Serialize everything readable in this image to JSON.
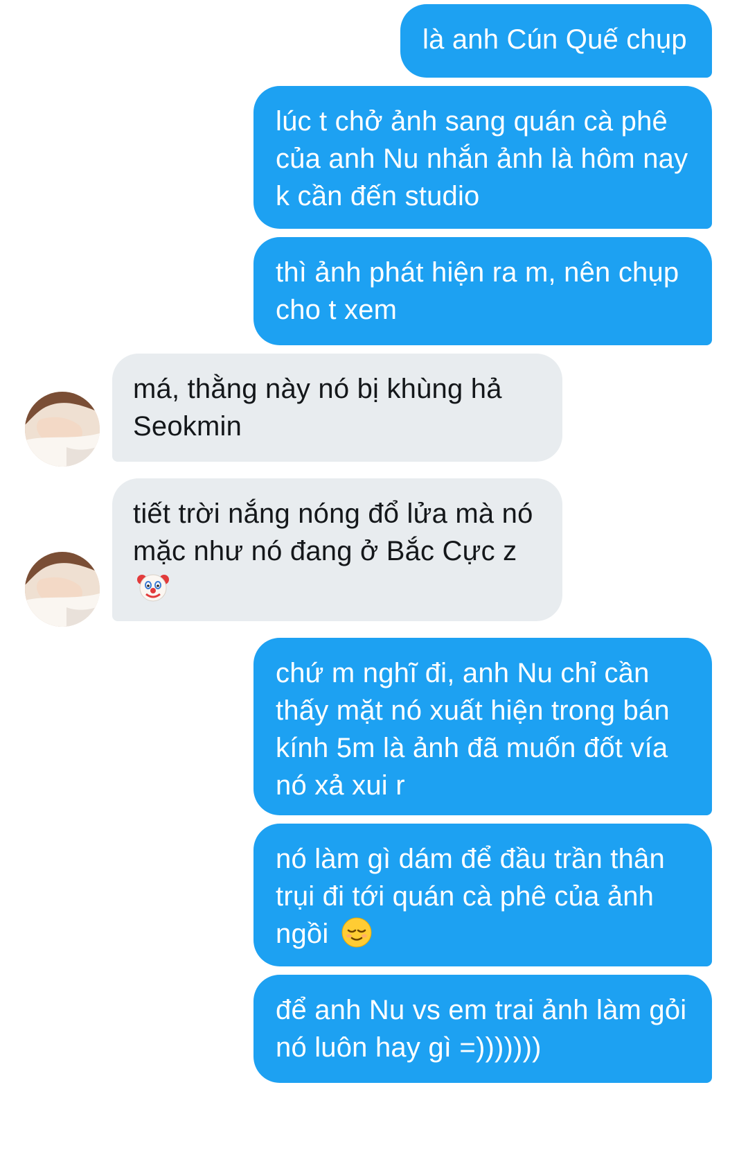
{
  "conversation": {
    "messages": [
      {
        "side": "out",
        "text": "là anh Cún Quế chụp"
      },
      {
        "side": "out",
        "text": "lúc t chở ảnh sang quán cà phê của anh Nu nhắn ảnh là hôm nay k cần đến studio"
      },
      {
        "side": "out",
        "text": "thì ảnh phát hiện ra m, nên chụp cho t xem"
      },
      {
        "side": "in",
        "text": "má, thằng này nó bị khùng hả Seokmin"
      },
      {
        "side": "in",
        "text": "tiết trời nắng nóng đổ lửa mà nó mặc như nó đang ở Bắc Cực z",
        "emoji": "clown-face"
      },
      {
        "side": "out",
        "text": "chứ m nghĩ đi, anh Nu chỉ cần thấy mặt nó xuất hiện trong bán kính 5m là ảnh đã muốn đốt vía nó xả xui r"
      },
      {
        "side": "out",
        "text": "nó làm gì dám để đầu trần thân trụi đi tới quán cà phê của ảnh ngồi",
        "emoji": "relieved-face"
      },
      {
        "side": "out",
        "text": "để anh Nu vs em trai ảnh làm gỏi nó luôn hay gì =)))))))"
      }
    ]
  },
  "colors": {
    "outgoing_bubble": "#1da1f2",
    "incoming_bubble": "#e8ecef",
    "outgoing_text": "#ffffff",
    "incoming_text": "#14171a"
  }
}
